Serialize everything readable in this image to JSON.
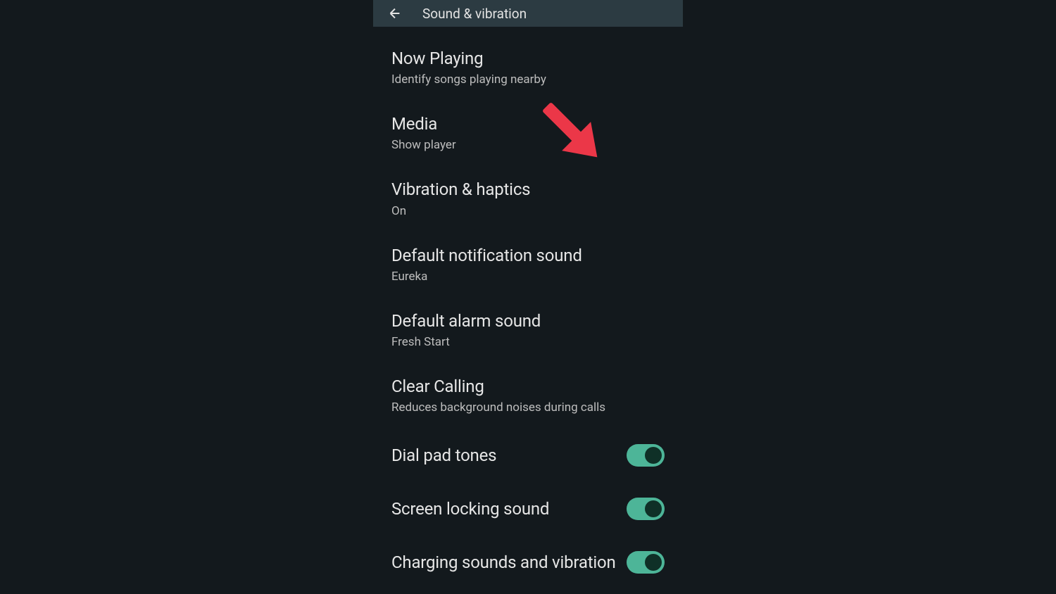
{
  "header": {
    "title": "Sound & vibration"
  },
  "settings": {
    "now_playing": {
      "title": "Now Playing",
      "subtitle": "Identify songs playing nearby"
    },
    "media": {
      "title": "Media",
      "subtitle": "Show player"
    },
    "vibration_haptics": {
      "title": "Vibration & haptics",
      "subtitle": "On"
    },
    "notification_sound": {
      "title": "Default notification sound",
      "subtitle": "Eureka"
    },
    "alarm_sound": {
      "title": "Default alarm sound",
      "subtitle": "Fresh Start"
    },
    "clear_calling": {
      "title": "Clear Calling",
      "subtitle": "Reduces background noises during calls"
    },
    "dial_pad_tones": {
      "label": "Dial pad tones",
      "enabled": true
    },
    "screen_locking_sound": {
      "label": "Screen locking sound",
      "enabled": true
    },
    "charging_sounds": {
      "label": "Charging sounds and vibration",
      "enabled": true
    }
  },
  "annotation": {
    "type": "arrow",
    "color": "#e84050",
    "target": "vibration-haptics-item"
  }
}
